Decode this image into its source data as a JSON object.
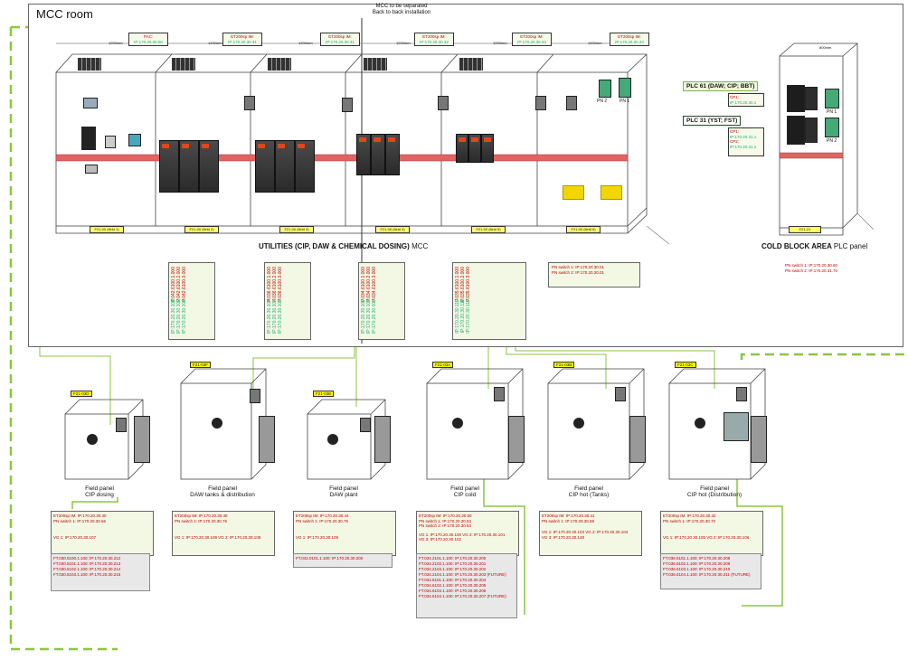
{
  "room": {
    "title": "MCC room",
    "note_line1": "MCC to be separated",
    "note_line2": "Back to back installation"
  },
  "mcc": {
    "caption": "UTILITIES (CIP, DAW & CHEMICAL DOSING)",
    "caption_suffix": "MCC",
    "cabinet_labels": [
      "F21-00 (field 1)",
      "F21-00 (field 2)",
      "F21-00 (field 3)",
      "F21-00 (field 4)",
      "F21-00 (field 5)",
      "F21-00 (field 6)"
    ],
    "et_boxes": [
      {
        "title": "PAC:",
        "ip": "IP:170.20.30.00"
      },
      {
        "title": "ET200sp IM:",
        "ip": "IP:170.20.30.31"
      },
      {
        "title": "ET200sp IM:",
        "ip": "IP:170.20.30.31"
      },
      {
        "title": "ET200sp IM:",
        "ip": "IP:170.20.30.32"
      },
      {
        "title": "ET200sp IM:",
        "ip": "IP:170.20.30.33"
      },
      {
        "title": "ET200sp IM:",
        "ip": "IP:170.20.30.34"
      }
    ],
    "pn_labels": [
      "PN 2",
      "PN 1"
    ],
    "pn_switches": [
      "PN switch 1: IP:170.20.30.01",
      "PN switch 2: IP:170.20.30.01"
    ],
    "dims": [
      "1200mm",
      "1200mm",
      "1200mm",
      "1200mm",
      "1200mm",
      "1200mm"
    ],
    "vfd_tables": [
      {
        "red": [
          "P.042.6100.1.000",
          "P.042.6100.2.000",
          "P.042.6100.3.000"
        ],
        "green": [
          "IP:170.20.30.101",
          "IP:170.20.30.102",
          "IP:170.20.30.103"
        ]
      },
      {
        "red": [
          "P.036.6100.1.000",
          "P.036.6100.2.000",
          "P.036.6100.3.000"
        ],
        "green": [
          "IP:170.20.30.104",
          "IP:170.20.30.105",
          "IP:170.20.30.106"
        ]
      },
      {
        "red": [
          "P.034.6100.1.000",
          "P.034.6100.2.000",
          "P.034.6100.3.000"
        ],
        "green": [
          "IP:170.20.30.107",
          "IP:170.20.30.108",
          "IP:170.20.30.109"
        ]
      },
      {
        "red": [
          "P.035.6100.1.000",
          "P.035.6100.2.000",
          "P.035.6100.3.000"
        ],
        "green": [
          "IP:170.20.30.110",
          "IP:170.20.30.111",
          "IP:170.20.30.112"
        ]
      }
    ]
  },
  "cold": {
    "caption": "COLD BLOCK AREA",
    "caption_suffix": "PLC panel",
    "cabinet_label": "F21-21",
    "dim_top": "800mm",
    "plc61": "PLC 61 (DAW; CIP; BBT)",
    "plc31": "PLC 31 (YST; FST)",
    "cp1_a": "CP1:",
    "cp1_a_ip": "IP:170.20.30.1",
    "cp1_b": "CP1:",
    "cp1_b_ip": "IP:170.20.31.1",
    "cp2_b": "CP2:",
    "cp2_b_ip": "IP:170.20.31.2",
    "pn_labels": [
      "PN 1",
      "PN 2"
    ],
    "pn_switch1": "PN switch 1: IP:170.20.30.60",
    "pn_switch2": "PN switch 2: IP:170.20.31.70"
  },
  "panels": [
    {
      "tag": "F21-03D",
      "name1": "Field panel",
      "name2": "CIP dosing",
      "lines": [
        "ET200sp IM: IP:170.20.30.40",
        "PN switch 1: IP:170.20.30.66"
      ],
      "vg": [
        "VG 1:  IP:170.20.30.107"
      ],
      "ft": [
        "FT.030.5100.1.100:  IP:170.20.30.212",
        "FT.030.5101.1.100:  IP:170.20.30.213",
        "FT.030.5102.1.100:  IP:170.20.30.214",
        "FT.030.5103.1.100:  IP:170.20.30.215"
      ]
    },
    {
      "tag": "F21-03F",
      "name1": "Field panel",
      "name2": "DAW tanks & distribution",
      "lines": [
        "ET200sp IM: IP:170.20.30.48",
        "PN switch 1: IP:170.20.30.76"
      ],
      "vg": [
        "VG 1:  IP:170.20.30.109  VG 2:  IP:170.20.30.108"
      ],
      "ft": []
    },
    {
      "tag": "F21-03E",
      "name1": "Field panel",
      "name2": "DAW plant",
      "lines": [
        "ET200sp IM: IP:170.20.30.44",
        "PN switch 1: IP:170.20.30.75"
      ],
      "vg": [
        "VG 1:  IP:170.20.30.109"
      ],
      "ft": [
        "FT.042.0101.1.100:  IP:170.20.30.200"
      ]
    },
    {
      "tag": "F21-03A",
      "name1": "Field panel",
      "name2": "CIP cold",
      "lines": [
        "ET200sp IM: IP:170.20.30.50",
        "PN switch 1: IP:170.20.30.63",
        "PN switch 2: IP:170.20.30.64"
      ],
      "vg": [
        "VG 1:  IP:170.20.30.100  VG 2:  IP:170.20.30.101",
        "VG 3:  IP:170.20.30.102"
      ],
      "ft": [
        "FT.034.2101.1.100:  IP:170.20.30.200",
        "FT.034.2102.1.100:  IP:170.20.30.201",
        "FT.034.2103.1.100:  IP:170.20.30.202",
        "FT.034.2104.1.100:  IP:170.20.30.203 (FUTURE)",
        "FT.034.6101.1.100:  IP:170.20.30.204",
        "FT.034.6102.1.100:  IP:170.20.30.205",
        "FT.034.6103.1.100:  IP:170.20.30.206",
        "FT.034.6104.1.100:  IP:170.20.30.207 (FUTURE)"
      ]
    },
    {
      "tag": "F21-03B",
      "name1": "Field panel",
      "name2": "CIP hot (Tanks)",
      "lines": [
        "ET200sp IM: IP:170.20.30.41",
        "PN switch 1: IP:170.20.30.68"
      ],
      "vg": [
        "VG 1:  IP:170.20.30.103  VG 2:  IP:170.20.30.104",
        "VG 3:  IP:170.20.30.148"
      ],
      "ft": []
    },
    {
      "tag": "F21-03C",
      "name1": "Field panel",
      "name2": "CIP hot (Distribution)",
      "lines": [
        "ET200sp IM: IP:170.20.30.42",
        "PN switch 1: IP:170.20.30.70"
      ],
      "vg": [
        "VG 1:  IP:170.20.30.105  VG 2:  IP:170.20.30.106"
      ],
      "ft": [
        "FT.036.6101.1.100:  IP:170.20.30.208",
        "FT.036.6102.1.100:  IP:170.20.30.209",
        "FT.036.6103.1.100:  IP:170.20.30.210",
        "FT.036.6104.1.100:  IP:170.20.30.211 (FUTURE)"
      ]
    }
  ]
}
